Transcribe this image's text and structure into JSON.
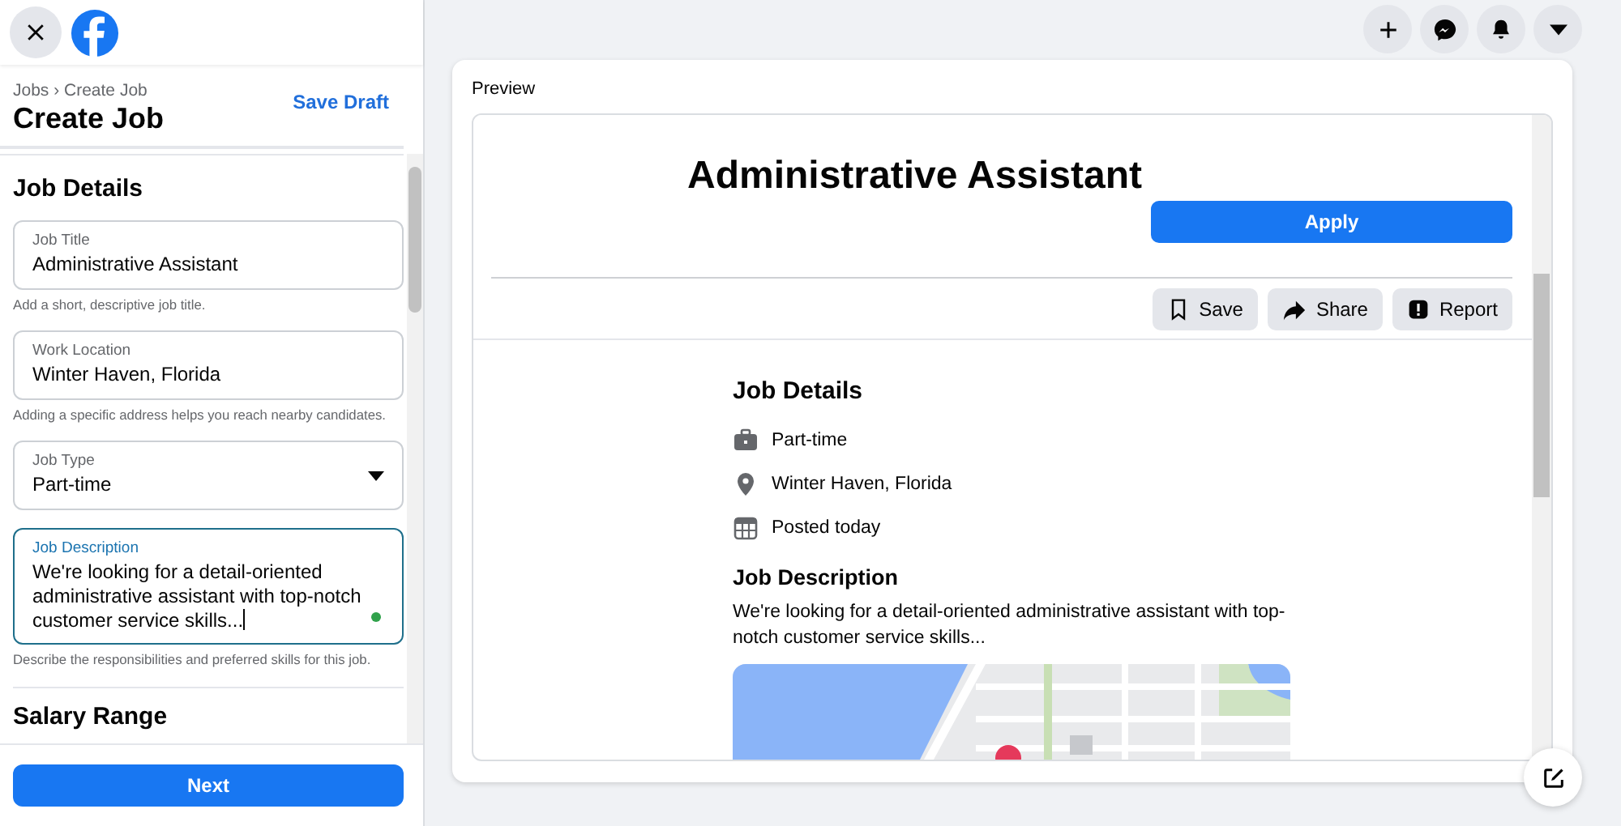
{
  "breadcrumb": "Jobs › Create Job",
  "page_title": "Create Job",
  "save_draft": "Save Draft",
  "form": {
    "section_title": "Job Details",
    "fields": [
      {
        "kind": "text",
        "label": "Job Title",
        "value": "Administrative Assistant",
        "hint": "Add a short, descriptive job title.",
        "focused": false
      },
      {
        "kind": "text",
        "label": "Work Location",
        "value": "Winter Haven, Florida",
        "hint": "Adding a specific address helps you reach nearby candidates.",
        "focused": false
      },
      {
        "kind": "select",
        "label": "Job Type",
        "value": "Part-time",
        "focused": false
      },
      {
        "kind": "textarea",
        "label": "Job Description",
        "value": "We're looking for a detail-oriented administrative assistant with top-notch customer service skills...",
        "hint": "Describe the responsibilities and preferred skills for this job.",
        "focused": true
      }
    ],
    "next_section": "Salary Range"
  },
  "next_button": "Next",
  "preview": {
    "label": "Preview",
    "job_title": "Administrative Assistant",
    "apply": "Apply",
    "actions": [
      {
        "kind": "save",
        "label": "Save"
      },
      {
        "kind": "share",
        "label": "Share"
      },
      {
        "kind": "report",
        "label": "Report"
      }
    ],
    "details": {
      "title": "Job Details",
      "items": [
        {
          "kind": "job_type",
          "text": "Part-time"
        },
        {
          "kind": "location",
          "text": "Winter Haven, Florida"
        },
        {
          "kind": "posted",
          "text": "Posted today"
        }
      ],
      "description_title": "Job Description",
      "description": "We're looking for a detail-oriented administrative assistant with top-notch customer service skills..."
    }
  }
}
